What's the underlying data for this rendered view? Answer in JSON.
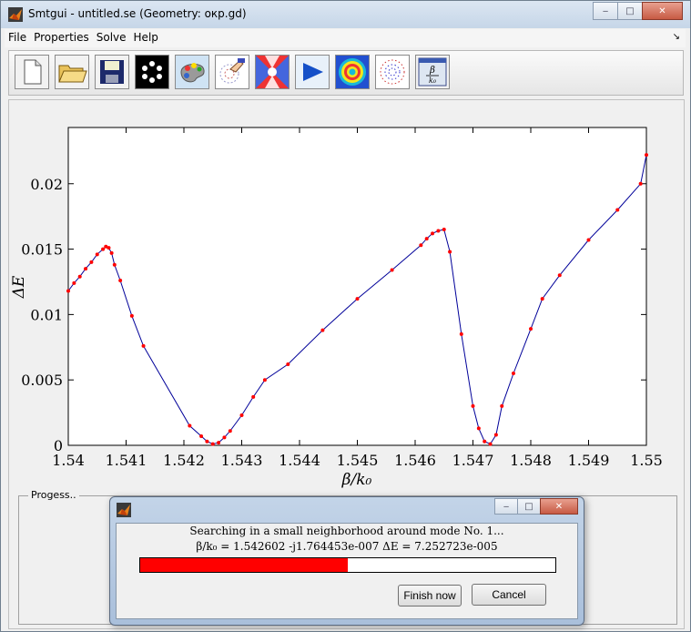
{
  "window": {
    "title": "Smtgui - untitled.se (Geometry: окр.gd)",
    "minimize": "‒",
    "maximize": "□",
    "close": "✕"
  },
  "menu": {
    "items": [
      "File",
      "Properties",
      "Solve",
      "Help"
    ],
    "arrow": "↘"
  },
  "toolbar": {
    "buttons": [
      {
        "name": "new-file-icon"
      },
      {
        "name": "open-folder-icon"
      },
      {
        "name": "save-disk-icon"
      },
      {
        "name": "geometry-circles-icon"
      },
      {
        "name": "palette-icon"
      },
      {
        "name": "mesh-hand-icon"
      },
      {
        "name": "field-pattern-icon"
      },
      {
        "name": "play-arrow-icon"
      },
      {
        "name": "rings-field-icon"
      },
      {
        "name": "dotted-rings-icon"
      },
      {
        "name": "beta-k0-icon"
      }
    ]
  },
  "chart_data": {
    "type": "line",
    "xlabel": "β/k₀",
    "ylabel": "ΔE",
    "xlim": [
      1.54,
      1.55
    ],
    "ylim": [
      0,
      0.0243
    ],
    "xticks": [
      "1.54",
      "1.541",
      "1.542",
      "1.543",
      "1.544",
      "1.545",
      "1.546",
      "1.547",
      "1.548",
      "1.549",
      "1.55"
    ],
    "yticks": [
      "0",
      "0.005",
      "0.01",
      "0.015",
      "0.02"
    ],
    "series_color": "#000099",
    "marker_color": "#ff0000",
    "x": [
      1.54,
      1.5401,
      1.5402,
      1.5403,
      1.5404,
      1.5405,
      1.5406,
      1.54065,
      1.5407,
      1.54075,
      1.5408,
      1.5409,
      1.5411,
      1.5413,
      1.5421,
      1.5423,
      1.5424,
      1.5425,
      1.5426,
      1.5427,
      1.5428,
      1.543,
      1.5432,
      1.5434,
      1.5438,
      1.5444,
      1.545,
      1.5456,
      1.5461,
      1.5462,
      1.5463,
      1.5464,
      1.5465,
      1.5466,
      1.5468,
      1.547,
      1.5471,
      1.5472,
      1.5473,
      1.5474,
      1.5475,
      1.5477,
      1.548,
      1.5482,
      1.5485,
      1.549,
      1.5495,
      1.5499,
      1.55
    ],
    "y": [
      0.0118,
      0.0124,
      0.0129,
      0.0135,
      0.014,
      0.0146,
      0.015,
      0.0152,
      0.0151,
      0.0147,
      0.0138,
      0.0126,
      0.0099,
      0.0076,
      0.0015,
      0.0007,
      0.0003,
      0.0001,
      0.0002,
      0.0006,
      0.0011,
      0.0023,
      0.0037,
      0.005,
      0.0062,
      0.0088,
      0.0112,
      0.0134,
      0.0153,
      0.0158,
      0.0162,
      0.0164,
      0.0165,
      0.0148,
      0.0085,
      0.003,
      0.0013,
      0.0003,
      0.0001,
      0.0008,
      0.003,
      0.0055,
      0.0089,
      0.0112,
      0.013,
      0.0157,
      0.018,
      0.02,
      0.0222
    ]
  },
  "progress": {
    "group_label": "Progess..",
    "line1": "Searching in a small neighborhood around mode No. 1...",
    "line2": "β/k₀ = 1.542602 -j1.764453e-007 ΔE = 7.252723e-005",
    "fraction": 0.5,
    "finish_label": "Finish now",
    "cancel_label": "Cancel"
  }
}
